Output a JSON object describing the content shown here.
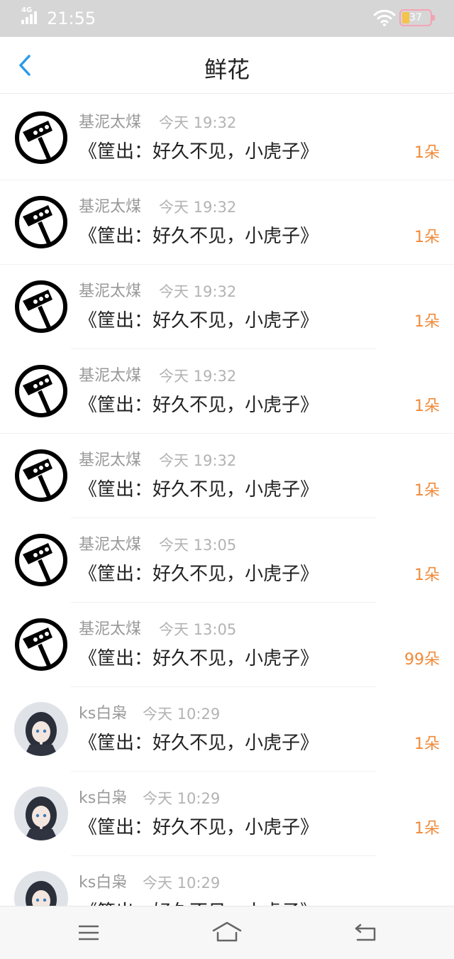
{
  "status_bar": {
    "network": "4G",
    "time": "21:55",
    "battery": "37",
    "icons": [
      "signal-icon",
      "wifi-icon",
      "battery-icon"
    ]
  },
  "nav": {
    "title": "鲜花",
    "back_icon": "chevron-left-icon"
  },
  "colors": {
    "accent_blue": "#2b9be8",
    "count_orange": "#f08a3a",
    "name_gray": "#999999",
    "time_gray": "#b3b3b3"
  },
  "items": [
    {
      "name": "基泥太煤",
      "time": "今天 19:32",
      "content": "《筐出：好久不见，小虎子》",
      "count": "1朵",
      "avatar": "badge-avatar"
    },
    {
      "name": "基泥太煤",
      "time": "今天 19:32",
      "content": "《筐出：好久不见，小虎子》",
      "count": "1朵",
      "avatar": "badge-avatar"
    },
    {
      "name": "基泥太煤",
      "time": "今天 19:32",
      "content": "《筐出：好久不见，小虎子》",
      "count": "1朵",
      "avatar": "badge-avatar"
    },
    {
      "name": "基泥太煤",
      "time": "今天 19:32",
      "content": "《筐出：好久不见，小虎子》",
      "count": "1朵",
      "avatar": "badge-avatar"
    },
    {
      "name": "基泥太煤",
      "time": "今天 19:32",
      "content": "《筐出：好久不见，小虎子》",
      "count": "1朵",
      "avatar": "badge-avatar"
    },
    {
      "name": "基泥太煤",
      "time": "今天 13:05",
      "content": "《筐出：好久不见，小虎子》",
      "count": "1朵",
      "avatar": "badge-avatar"
    },
    {
      "name": "基泥太煤",
      "time": "今天 13:05",
      "content": "《筐出：好久不见，小虎子》",
      "count": "99朵",
      "avatar": "badge-avatar"
    },
    {
      "name": "ks白枭",
      "time": "今天 10:29",
      "content": "《筐出：好久不见，小虎子》",
      "count": "1朵",
      "avatar": "anime-avatar"
    },
    {
      "name": "ks白枭",
      "time": "今天 10:29",
      "content": "《筐出：好久不见，小虎子》",
      "count": "1朵",
      "avatar": "anime-avatar"
    },
    {
      "name": "ks白枭",
      "time": "今天 10:29",
      "content": "《筐出：好久不见，小虎子》",
      "count": "",
      "avatar": "anime-avatar"
    }
  ],
  "bottom_nav": {
    "icons": [
      "menu-icon",
      "home-icon",
      "back-icon"
    ]
  }
}
